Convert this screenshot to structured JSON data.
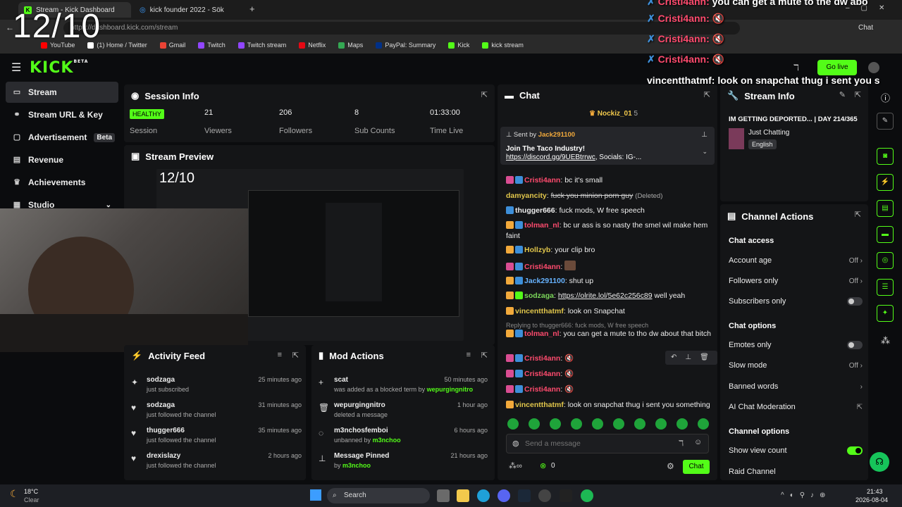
{
  "browser": {
    "tabs": [
      {
        "title": "Stream - Kick Dashboard",
        "active": true
      },
      {
        "title": "kick founder 2022 - Sök",
        "active": false
      }
    ],
    "url": "https://dashboard.kick.com/stream",
    "bookmarks": [
      "YouTube",
      "(1) Home / Twitter",
      "Gmail",
      "Twitch",
      "Twitch stream",
      "Netflix",
      "Maps",
      "PayPal: Summary",
      "Kick",
      "kick stream"
    ],
    "profile_label": "Chat"
  },
  "overlay": {
    "date": "12/10",
    "messages": [
      {
        "user": "Cristi4ann:",
        "text": "you can get a mute to the dw abo"
      },
      {
        "user": "Cristi4ann:",
        "text": ""
      },
      {
        "user": "Cristi4ann:",
        "text": ""
      },
      {
        "user": "Cristi4ann:",
        "text": ""
      },
      {
        "user": "vincentthatmf:",
        "text": "look on snapchat thug i sent you s"
      }
    ]
  },
  "header": {
    "logo": "KICK",
    "logo_badge": "BETA",
    "go_live": "Go live"
  },
  "sidebar": {
    "items": [
      {
        "label": "Stream",
        "active": true
      },
      {
        "label": "Stream URL & Key"
      },
      {
        "label": "Advertisement",
        "badge": "Beta"
      },
      {
        "label": "Revenue"
      },
      {
        "label": "Achievements"
      },
      {
        "label": "Studio"
      }
    ]
  },
  "session_info": {
    "title": "Session Info",
    "health": "HEALTHY",
    "health_label": "Session",
    "viewers": "21",
    "viewers_label": "Viewers",
    "followers": "206",
    "followers_label": "Followers",
    "subs": "8",
    "subs_label": "Sub Counts",
    "time": "01:33:00",
    "time_label": "Time Live"
  },
  "stream_preview": {
    "title": "Stream Preview",
    "date_overlay": "12/10"
  },
  "activity_feed": {
    "title": "Activity Feed",
    "items": [
      {
        "name": "sodzaga",
        "action": "just subscribed",
        "time": "25 minutes ago"
      },
      {
        "name": "sodzaga",
        "action": "just followed the channel",
        "time": "31 minutes ago"
      },
      {
        "name": "thugger666",
        "action": "just followed the channel",
        "time": "35 minutes ago"
      },
      {
        "name": "drexislazy",
        "action": "just followed the channel",
        "time": "2 hours ago"
      }
    ]
  },
  "mod_actions": {
    "title": "Mod Actions",
    "items": [
      {
        "name": "scat",
        "action": "was added as a blocked term by",
        "by": "wepurgingnitro",
        "time": "50 minutes ago"
      },
      {
        "name": "wepurgingnitro",
        "action": "deleted a message",
        "by": "",
        "time": "1 hour ago"
      },
      {
        "name": "m3nchosfemboi",
        "action": "unbanned by",
        "by": "m3nchoo",
        "time": "6 hours ago"
      },
      {
        "name": "Message Pinned",
        "action": "by",
        "by": "m3nchoo",
        "time": "21 hours ago"
      }
    ]
  },
  "chat": {
    "title": "Chat",
    "top_user": "Nockiz_01",
    "top_count": "5",
    "pinned_sender_prefix": "Sent by",
    "pinned_sender": "Jack291100",
    "pinned_text": "Join The Taco Industry!",
    "pinned_link": "https://discord.gg/9UEBtrrwc",
    "pinned_rest": ", Socials: IG-...",
    "messages": [
      {
        "user": "Cristi4ann",
        "text": "bc it's small"
      },
      {
        "user": "damyancity",
        "text": "fuck you minion porn guy",
        "note": "(Deleted)"
      },
      {
        "user": "thugger666",
        "text": "fuck mods, W free speech"
      },
      {
        "user": "tolman_nl",
        "text": "bc ur ass is so nasty the smel wil make hem faint"
      },
      {
        "user": "Hollzyb",
        "text": "your clip bro"
      },
      {
        "user": "Cristi4ann",
        "text": ""
      },
      {
        "user": "Jack291100",
        "text": "shut up"
      },
      {
        "user": "sodzaga",
        "text": "https://olrite.lol/5e62c256c89",
        "after": "well yeah"
      },
      {
        "user": "vincentthatmf",
        "text": "look on Snapchat"
      },
      {
        "reply": "Replying to thugger666: fuck mods, W free speech"
      },
      {
        "user": "tolman_nl",
        "text": "you can get a mute to tho dw about that bitch"
      },
      {
        "user": "Cristi4ann",
        "text": ""
      },
      {
        "user": "Cristi4ann",
        "text": ""
      },
      {
        "user": "Cristi4ann",
        "text": ""
      },
      {
        "user": "vincentthatmf",
        "text": "look on snapchat thug i sent you something"
      }
    ],
    "input_placeholder": "Send a message",
    "points": "0",
    "send_label": "Chat"
  },
  "stream_info": {
    "title": "Stream Info",
    "stream_title": "IM GETTING DEPORTED... | DAY 214/365",
    "category": "Just Chatting",
    "language": "English"
  },
  "channel_actions": {
    "title": "Channel Actions",
    "chat_access": "Chat access",
    "account_age": "Account age",
    "account_age_value": "Off",
    "followers_only": "Followers only",
    "followers_only_value": "Off",
    "subscribers_only": "Subscribers only",
    "chat_options": "Chat options",
    "emotes_only": "Emotes only",
    "slow_mode": "Slow mode",
    "slow_mode_value": "Off",
    "banned_words": "Banned words",
    "ai_moderation": "AI Chat Moderation",
    "channel_options": "Channel options",
    "show_view_count": "Show view count",
    "raid_channel": "Raid Channel"
  },
  "taskbar": {
    "weather_temp": "18°C",
    "weather_desc": "Clear",
    "search": "Search",
    "time": "21:43",
    "date": "2026-08-04"
  }
}
